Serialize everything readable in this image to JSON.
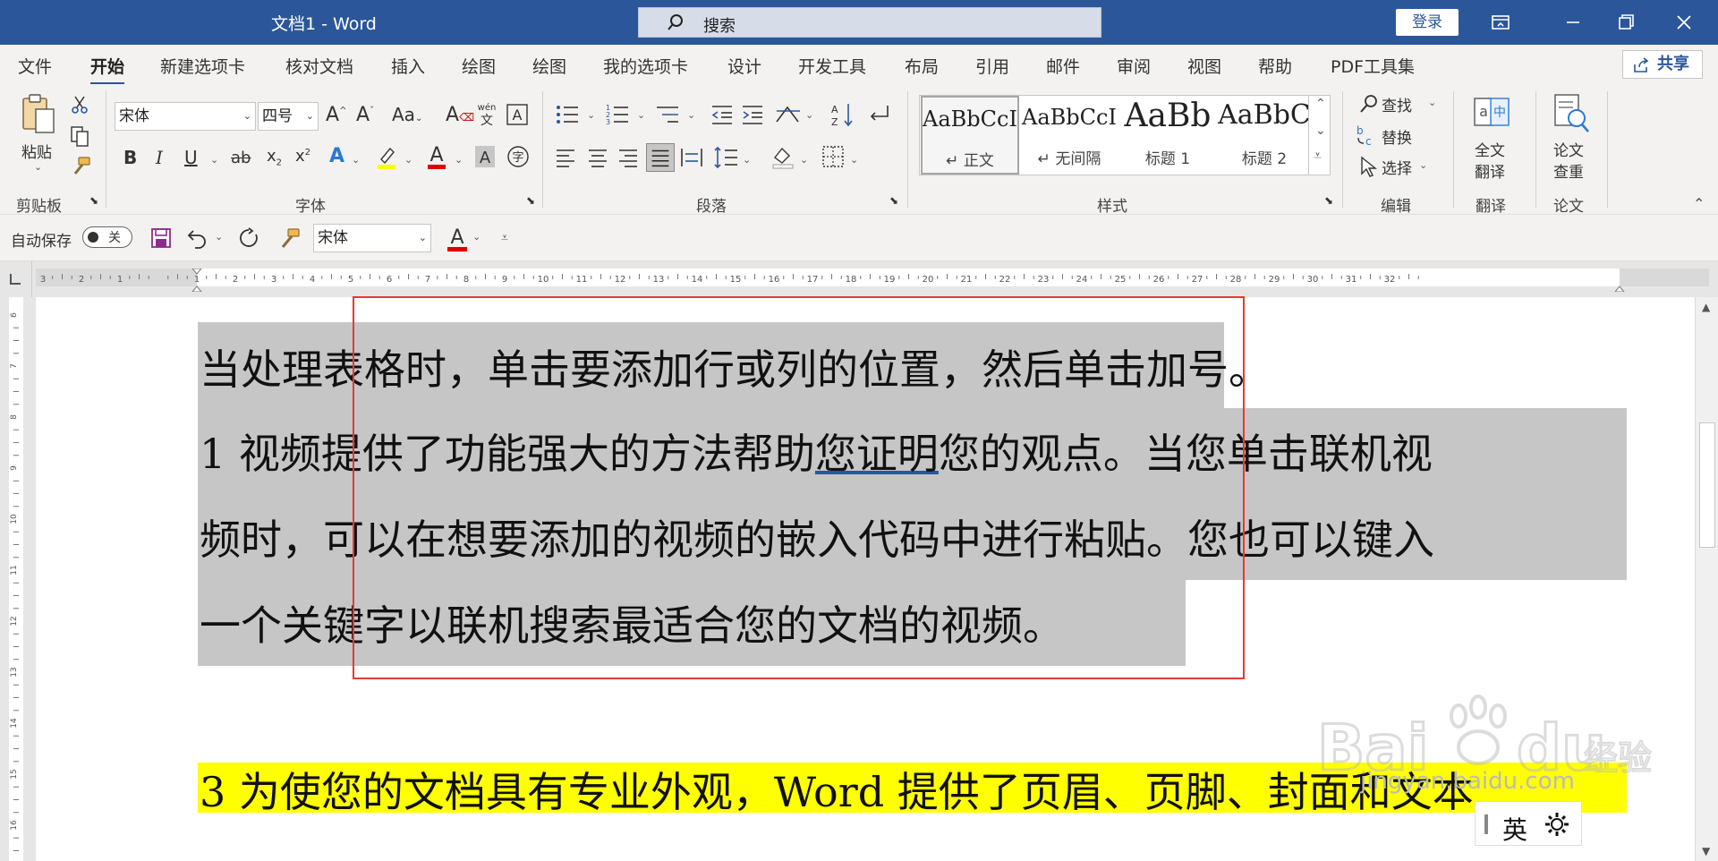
{
  "titlebar": {
    "document_title": "文档1  -  Word",
    "search_label": "搜索",
    "login_label": "登录"
  },
  "menu": {
    "tabs": [
      "文件",
      "开始",
      "新建选项卡",
      "核对文档",
      "插入",
      "绘图",
      "绘图",
      "我的选项卡",
      "设计",
      "开发工具",
      "布局",
      "引用",
      "邮件",
      "审阅",
      "视图",
      "帮助",
      "PDF工具集"
    ],
    "active_tab": "开始",
    "share_label": "共享"
  },
  "ribbon": {
    "clipboard": {
      "paste_label": "粘贴",
      "group_label": "剪贴板"
    },
    "font": {
      "font_name": "宋体",
      "font_size": "四号",
      "case_label": "Aa",
      "phonetic_label": "wén 文",
      "group_label": "字体"
    },
    "paragraph": {
      "group_label": "段落"
    },
    "styles": {
      "items": [
        {
          "sample": "AaBbCcI",
          "name": "↵ 正文"
        },
        {
          "sample": "AaBbCcI",
          "name": "↵ 无间隔"
        },
        {
          "sample": "AaBb",
          "name": "标题 1"
        },
        {
          "sample": "AaBbC",
          "name": "标题 2"
        }
      ],
      "group_label": "样式"
    },
    "editing": {
      "find_label": "查找",
      "replace_label": "替换",
      "select_label": "选择",
      "group_label": "编辑"
    },
    "translate": {
      "button_label": "全文\n翻译",
      "line1": "全文",
      "line2": "翻译",
      "group_label": "翻译"
    },
    "thesis": {
      "line1": "论文",
      "line2": "查重",
      "group_label": "论文"
    }
  },
  "quick_access": {
    "autosave_label": "自动保存",
    "autosave_state": "关",
    "font_name": "宋体"
  },
  "ruler": {
    "h_ticks": [
      "3",
      "2",
      "1",
      "",
      "1",
      "2",
      "3",
      "4",
      "5",
      "6",
      "7",
      "8",
      "9",
      "10",
      "11",
      "12",
      "13",
      "14",
      "15",
      "16",
      "17",
      "18",
      "19",
      "20",
      "21",
      "22",
      "23",
      "24",
      "25",
      "26",
      "27",
      "28",
      "29",
      "30",
      "31",
      "32"
    ],
    "v_ticks": [
      "6",
      "7",
      "8",
      "9",
      "10",
      "11",
      "12",
      "13",
      "14",
      "15",
      "16"
    ]
  },
  "document": {
    "line1": "当处理表格时，单击要添加行或列的位置，然后单击加号。",
    "line2_pre": "1 视频提供了功能强大的方法帮助",
    "line2_ul": "您证明",
    "line2_post": "您的观点。当您单击联机视",
    "line3": "频时，可以在想要添加的视频的嵌入代码中进行粘贴。您也可以键入",
    "line4": "一个关键字以联机搜索最适合您的文档的视频。",
    "line5": "3 为使您的文档具有专业外观，Word 提供了页眉、页脚、封面和文本"
  },
  "ime": {
    "lang": "英"
  },
  "watermark": {
    "text": "jingyan.baidu.com"
  },
  "colors": {
    "titlebar": "#2b579a",
    "selection_highlight": "#c6c6c6",
    "yellow_highlight": "#ffff00",
    "red_box": "#e53935"
  }
}
